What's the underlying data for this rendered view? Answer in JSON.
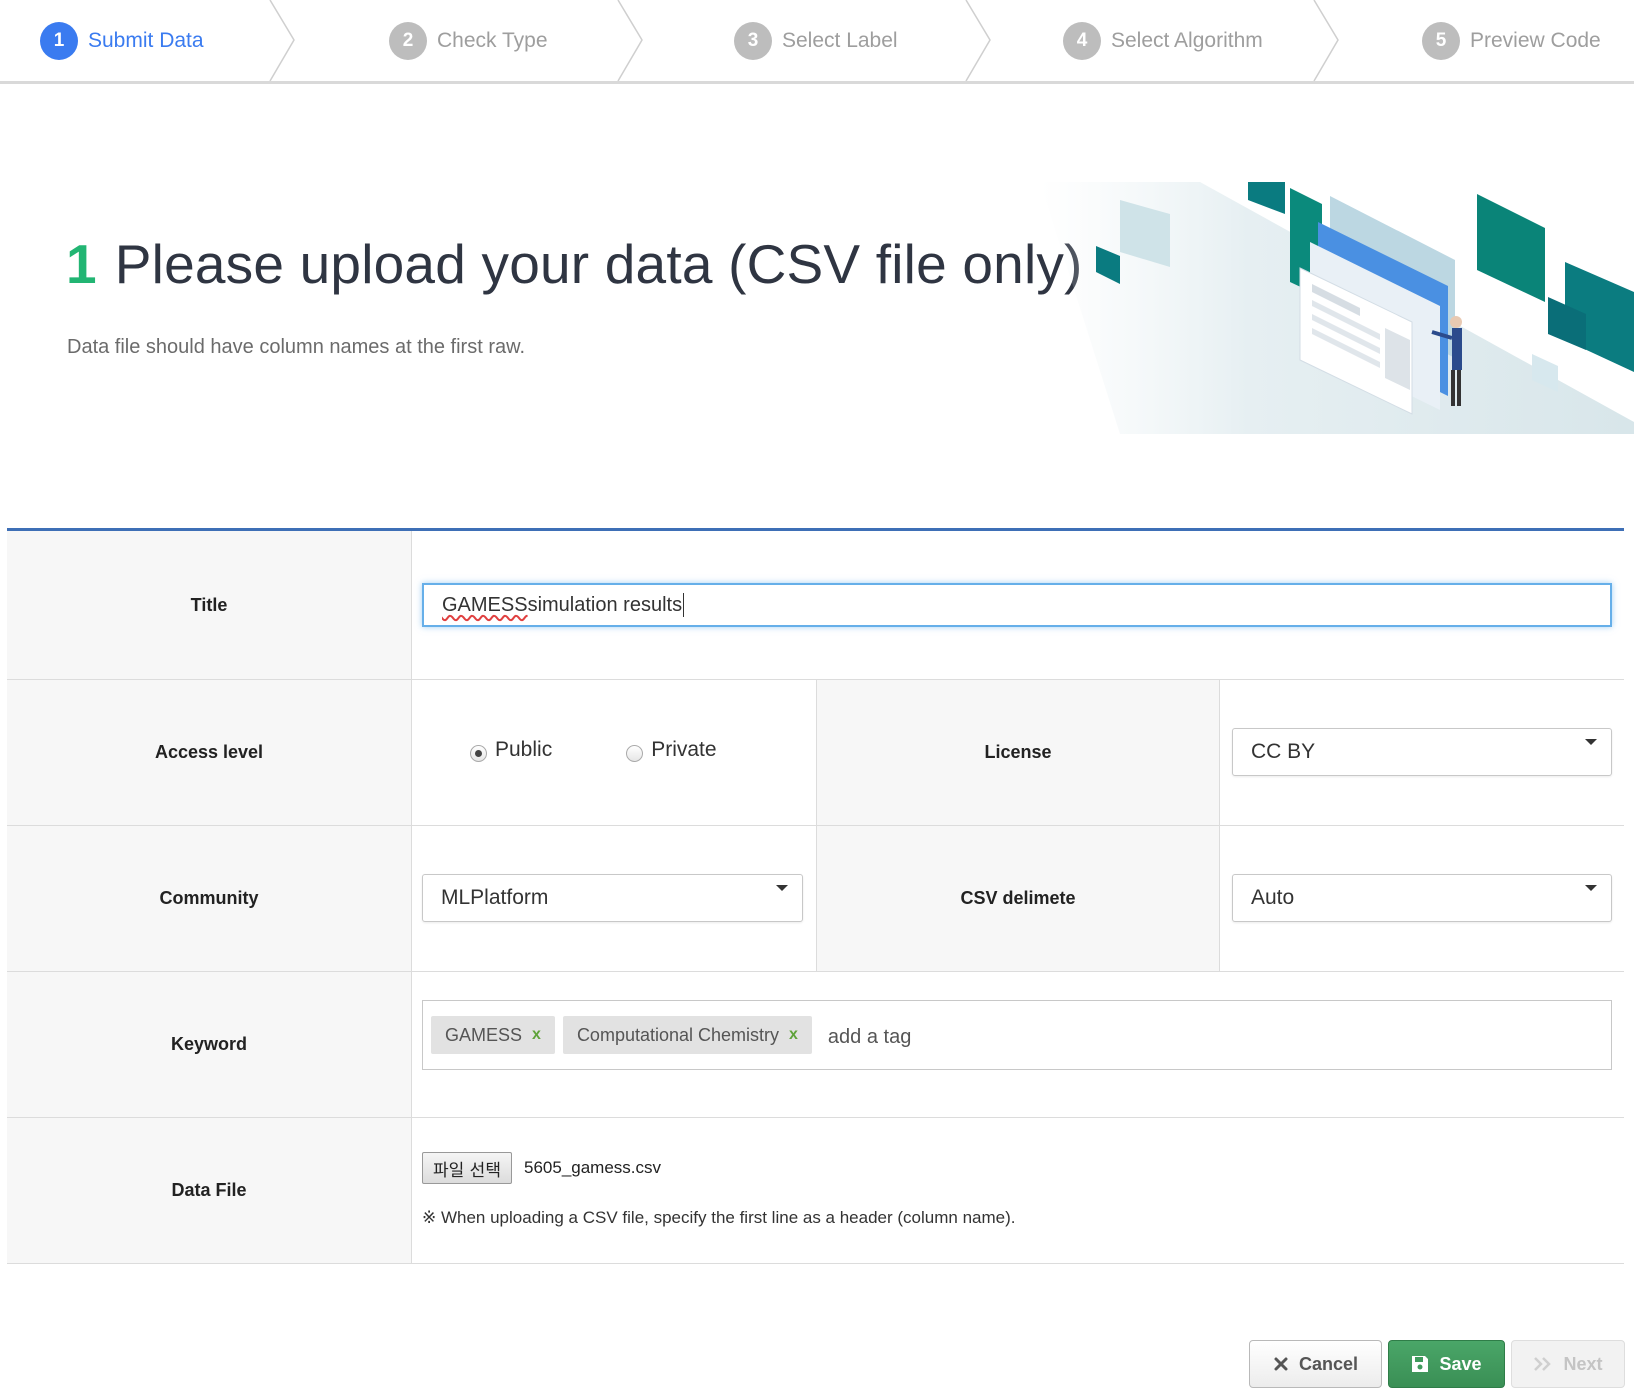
{
  "stepper": {
    "steps": [
      {
        "num": "1",
        "label": "Submit Data"
      },
      {
        "num": "2",
        "label": "Check Type"
      },
      {
        "num": "3",
        "label": "Select Label"
      },
      {
        "num": "4",
        "label": "Select Algorithm"
      },
      {
        "num": "5",
        "label": "Preview Code"
      }
    ],
    "active_step": "1"
  },
  "hero": {
    "number": "1",
    "title": "Please upload your data (CSV file only)",
    "subtitle": "Data file should have column names at the first raw."
  },
  "form": {
    "title": {
      "label": "Title",
      "value_spellchecked": "GAMESS",
      "value_rest": " simulation results"
    },
    "access_level": {
      "label": "Access level",
      "options": [
        "Public",
        "Private"
      ],
      "selected": "Public"
    },
    "license": {
      "label": "License",
      "value": "CC BY"
    },
    "community": {
      "label": "Community",
      "value": "MLPlatform"
    },
    "csv_delimeter": {
      "label": "CSV delimete",
      "value": "Auto"
    },
    "keyword": {
      "label": "Keyword",
      "tags": [
        "GAMESS",
        "Computational Chemistry"
      ],
      "tag_remove": "x",
      "placeholder": "add a tag"
    },
    "data_file": {
      "label": "Data File",
      "button_label": "파일 선택",
      "file_name": "5605_gamess.csv",
      "note": "※ When uploading a CSV file, specify the first line as a header (column name)."
    }
  },
  "actions": {
    "cancel": "Cancel",
    "save": "Save",
    "next": "Next"
  },
  "colors": {
    "accent": "#3a7bf0",
    "step_inactive": "#bdbdbd",
    "hero_number": "#22b573",
    "form_top_border": "#3e6fb6",
    "save": "#3f9a5c",
    "art_teal": "#007d7a",
    "art_blue": "#4a90e2"
  }
}
